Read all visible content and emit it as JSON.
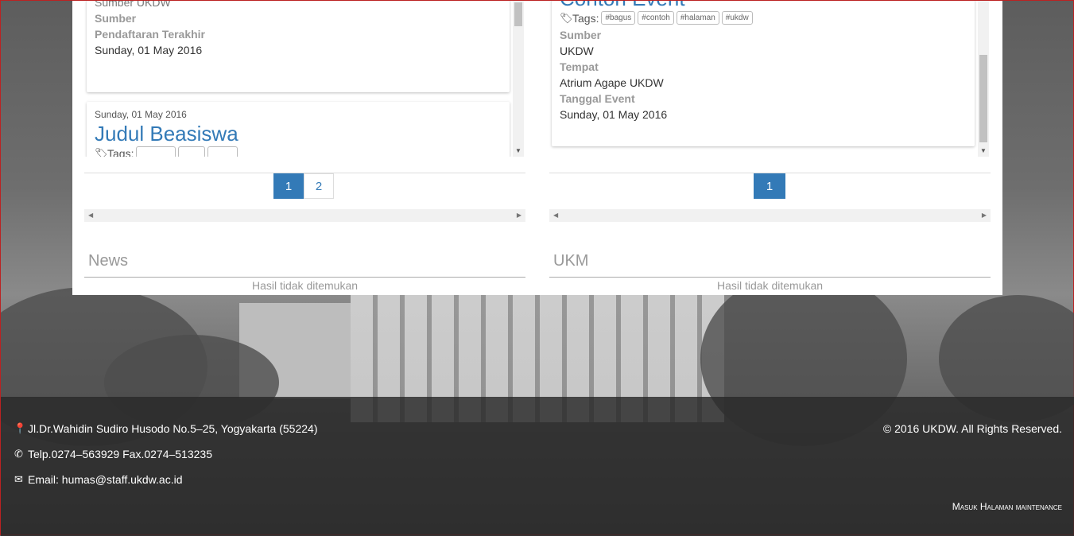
{
  "beasiswa": {
    "cut_top_text": "Sumber UKDW",
    "card1": {
      "sumber_label": "Sumber",
      "pendaftaran_label": "Pendaftaran Terakhir",
      "pendaftaran_value": "Sunday, 01 May 2016"
    },
    "card2": {
      "date": "Sunday, 01 May 2016",
      "title": "Judul Beasiswa",
      "tags_label": "Tags:"
    },
    "pages": [
      "1",
      "2"
    ],
    "active_page": "1"
  },
  "event": {
    "title": "Contoh Event",
    "tags_label": "Tags:",
    "tags": [
      "#bagus",
      "#contoh",
      "#halaman",
      "#ukdw"
    ],
    "sumber_label": "Sumber",
    "sumber_value": "UKDW",
    "tempat_label": "Tempat",
    "tempat_value": "Atrium Agape UKDW",
    "tanggal_label": "Tanggal Event",
    "tanggal_value": "Sunday, 01 May 2016",
    "pages": [
      "1"
    ],
    "active_page": "1"
  },
  "news": {
    "title": "News",
    "empty_text": "Hasil tidak ditemukan"
  },
  "ukm": {
    "title": "UKM",
    "empty_text": "Hasil tidak ditemukan"
  },
  "footer": {
    "address": "Jl.Dr.Wahidin Sudiro Husodo No.5–25, Yogyakarta (55224)",
    "phone": "Telp.0274–563929 Fax.0274–513235",
    "email": "Email: humas@staff.ukdw.ac.id",
    "copyright": "© 2016 UKDW. All Rights Reserved.",
    "maintenance_link": "Masuk Halaman maintenance"
  },
  "colors": {
    "accent": "#337ab7",
    "footer_bg": "#282828"
  }
}
